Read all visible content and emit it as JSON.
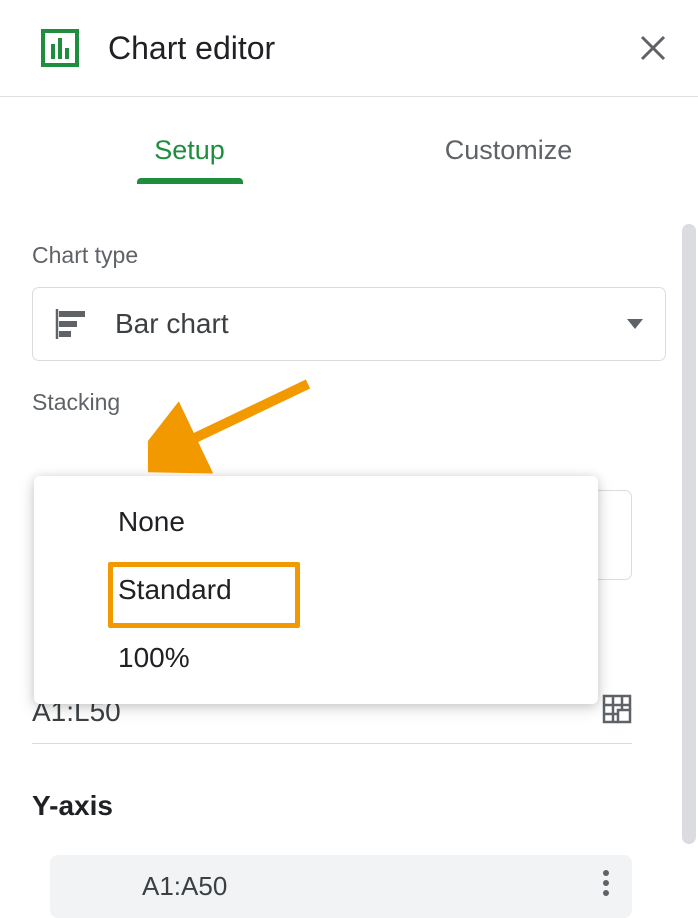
{
  "header": {
    "title": "Chart editor"
  },
  "tabs": {
    "setup": "Setup",
    "customize": "Customize"
  },
  "chartType": {
    "label": "Chart type",
    "value": "Bar chart"
  },
  "stacking": {
    "label": "Stacking",
    "options": {
      "none": "None",
      "standard": "Standard",
      "percent": "100%"
    }
  },
  "dataRange": {
    "value": "A1:L50"
  },
  "yaxis": {
    "label": "Y-axis",
    "value": "A1:A50"
  }
}
